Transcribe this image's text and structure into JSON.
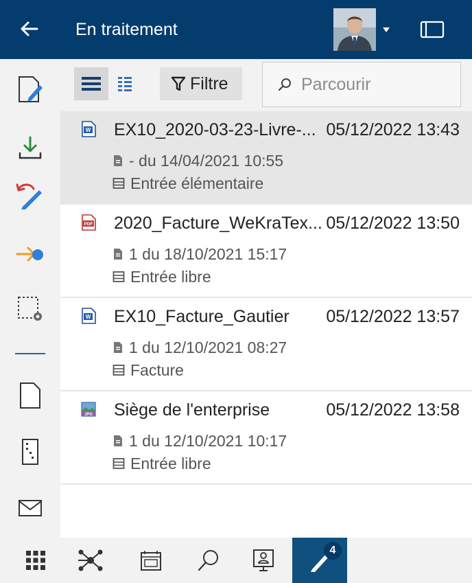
{
  "header": {
    "title": "En traitement",
    "back_icon": "arrow-left-icon",
    "window_icon": "window-icon",
    "background": "#053C6E"
  },
  "sidebar": {
    "items": [
      {
        "name": "edit-document-icon"
      },
      {
        "name": "download-icon"
      },
      {
        "name": "undo-checkout-icon"
      },
      {
        "name": "forward-workflow-icon"
      },
      {
        "name": "select-settings-icon"
      },
      {
        "name": "new-document-icon"
      },
      {
        "name": "new-folder-icon"
      },
      {
        "name": "mail-icon"
      }
    ]
  },
  "toolbar": {
    "filter_label": "Filtre",
    "search_placeholder": "Parcourir"
  },
  "documents": [
    {
      "name": "EX10_2020-03-23-Livre-...",
      "date": "05/12/2022 13:43",
      "version": "- du 14/04/2021 10:55",
      "mask": "Entrée élémentaire",
      "type": "word",
      "selected": true
    },
    {
      "name": "2020_Facture_WeKraTex...",
      "date": "05/12/2022 13:50",
      "version": "1 du 18/10/2021 15:17",
      "mask": "Entrée libre",
      "type": "pdf",
      "selected": false
    },
    {
      "name": "EX10_Facture_Gautier",
      "date": "05/12/2022 13:57",
      "version": "1 du 12/10/2021 08:27",
      "mask": "Facture",
      "type": "word",
      "selected": false
    },
    {
      "name": "Siège de l'enterprise",
      "date": "05/12/2022 13:58",
      "version": "1 du 12/10/2021 10:17",
      "mask": "Entrée libre",
      "type": "jpg",
      "selected": false
    }
  ],
  "bottombar": {
    "items": [
      "apps-grid-icon",
      "network-icon",
      "elo-archive-icon",
      "search-icon",
      "presentation-icon",
      "in-progress-icon"
    ],
    "badge_count": "4",
    "file_type_labels": {
      "word": "W",
      "pdf": "PDF",
      "jpg": "JPG"
    }
  },
  "colors": {
    "accent": "#053C6E",
    "active_tab": "#10507F",
    "selected_row": "#E6E6E6",
    "download_green": "#2E8B3E",
    "undo_red": "#D33A3A",
    "pen_blue": "#2E7FD6",
    "forward_orange": "#F39A1E"
  }
}
